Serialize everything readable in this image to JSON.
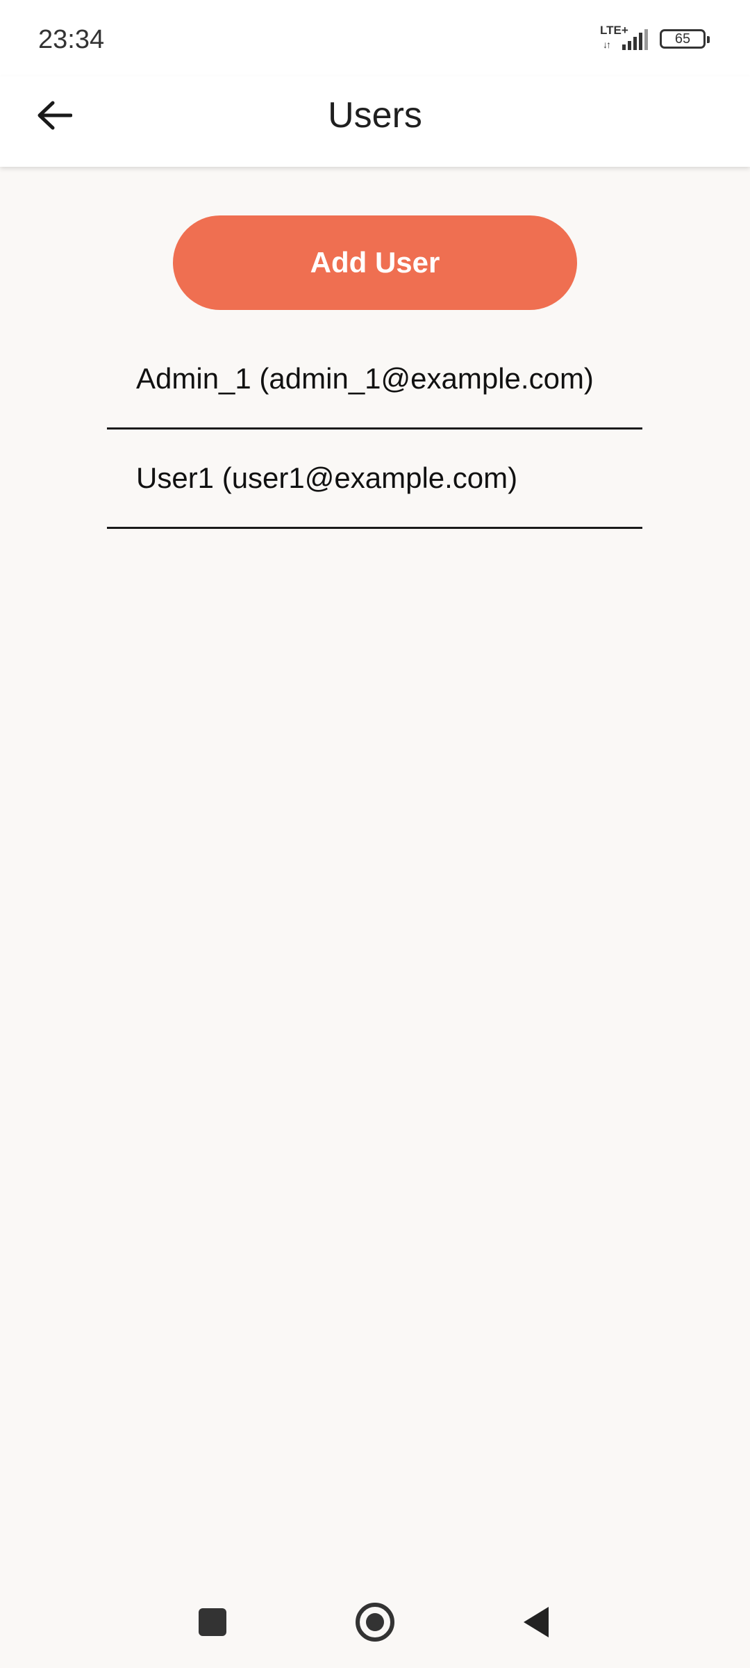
{
  "status_bar": {
    "time": "23:34",
    "network": "LTE+",
    "network_arrows": "↓↑",
    "battery": "65",
    "icons": [
      "signal-icon",
      "battery-icon"
    ]
  },
  "app_bar": {
    "title": "Users",
    "back_icon": "arrow-left-icon"
  },
  "actions": {
    "add_user_label": "Add User"
  },
  "users": [
    {
      "label": "Admin_1 (admin_1@example.com)"
    },
    {
      "label": "User1 (user1@example.com)"
    }
  ],
  "nav_bar": {
    "icons": [
      "recents-square-icon",
      "home-circle-icon",
      "back-triangle-icon"
    ]
  },
  "colors": {
    "accent": "#ef6f51",
    "background": "#faf8f6",
    "app_bar": "#ffffff",
    "text": "#1a1a1a"
  }
}
